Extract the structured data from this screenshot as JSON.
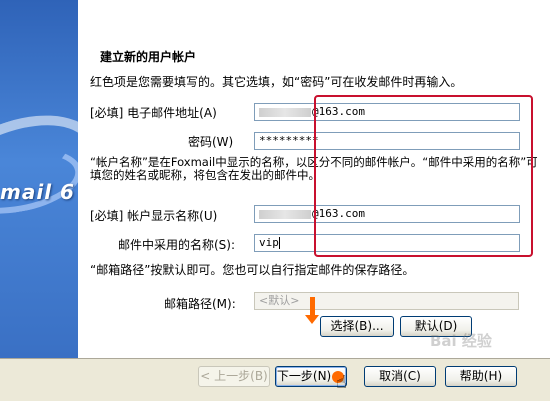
{
  "brand_text": "mail 6",
  "title": "建立新的用户帐户",
  "instruction": "红色项是您需要填写的。其它选填，如“密码”可在收发邮件时再输入。",
  "email": {
    "label": "[必填] 电子邮件地址(A)",
    "value_suffix": "@163.com"
  },
  "password": {
    "label": "密码(W)",
    "value": "*********"
  },
  "account_desc": "“帐户名称”是在Foxmail中显示的名称，以区分不同的邮件帐户。“邮件中采用的名称”可填您的姓名或昵称，将包含在发出的邮件中。",
  "display_name": {
    "label": "[必填] 帐户显示名称(U)",
    "value_suffix": "@163.com"
  },
  "sender_name": {
    "label": "邮件中采用的名称(S):",
    "value": "vip"
  },
  "path_desc": "“邮箱路径”按默认即可。您也可以自行指定邮件的保存路径。",
  "mailbox_path": {
    "label": "邮箱路径(M):",
    "placeholder": "<默认>"
  },
  "buttons": {
    "browse": "选择(B)...",
    "default": "默认(D)",
    "back": "< 上一步(B)",
    "next": "下一步(N) >",
    "cancel": "取消(C)",
    "help": "帮助(H)"
  },
  "watermark": "Bai 经验",
  "colors": {
    "highlight_box": "#c8102e",
    "arrow": "#ff6a00",
    "banner": "#3a70c4"
  },
  "icons": [
    "down-arrow-icon",
    "hand-cursor-icon"
  ]
}
